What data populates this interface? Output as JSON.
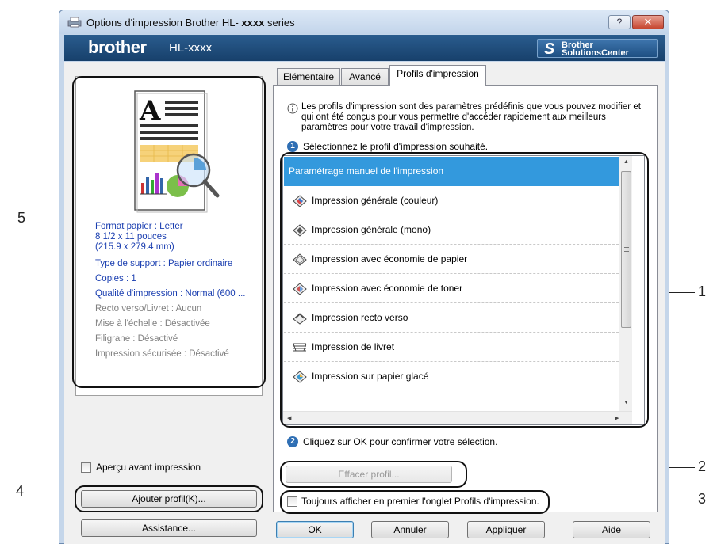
{
  "window": {
    "title_prefix": "Options d'impression Brother HL-",
    "title_model": "xxxx",
    "title_suffix": "series",
    "help_label": "?",
    "close_label": "✕"
  },
  "brand": {
    "logo": "brother",
    "model": "HL-xxxx",
    "solutions_line1": "Brother",
    "solutions_line2": "SolutionsCenter"
  },
  "summary": {
    "paper_format": "Format papier : Letter",
    "paper_dims": "8 1/2 x 11 pouces",
    "paper_mm": "(215.9 x 279.4 mm)",
    "media_type": "Type de support : Papier ordinaire",
    "copies": "Copies : 1",
    "quality": "Qualité d'impression : Normal (600 ...",
    "duplex": "Recto verso/Livret : Aucun",
    "scaling": "Mise à l'échelle : Désactivée",
    "watermark": "Filigrane : Désactivé",
    "secure": "Impression sécurisée : Désactivé"
  },
  "left": {
    "preview_checkbox": "Aperçu avant impression",
    "add_profile_button": "Ajouter profil(K)...",
    "support_button": "Assistance..."
  },
  "tabs": [
    "Elémentaire",
    "Avancé",
    "Profils d'impression"
  ],
  "profiles": {
    "intro": "Les profils d'impression sont des paramètres prédéfinis que vous pouvez modifier et qui ont été conçus pour vous permettre d'accéder rapidement aux meilleurs paramètres pour votre travail d'impression.",
    "step1": "Sélectionnez le profil d'impression souhaité.",
    "step2": "Cliquez sur OK pour confirmer votre sélection.",
    "items": [
      "Paramétrage manuel de l'impression",
      "Impression générale (couleur)",
      "Impression générale (mono)",
      "Impression avec économie de papier",
      "Impression avec économie de toner",
      "Impression recto verso",
      "Impression de livret",
      "Impression sur papier glacé"
    ],
    "selected_index": 0,
    "delete_button": "Effacer profil...",
    "always_show_checkbox": "Toujours afficher en premier l'onglet Profils d'impression."
  },
  "footer": {
    "ok": "OK",
    "cancel": "Annuler",
    "apply": "Appliquer",
    "help": "Aide"
  },
  "callouts": [
    "1",
    "2",
    "3",
    "4",
    "5"
  ],
  "step_numbers": [
    "1",
    "2"
  ],
  "colors": {
    "accent_blue": "#3399dd",
    "brand_bar": "#1f4f7f",
    "info_blue": "#1a3eb0",
    "callout_line": "#111111"
  }
}
